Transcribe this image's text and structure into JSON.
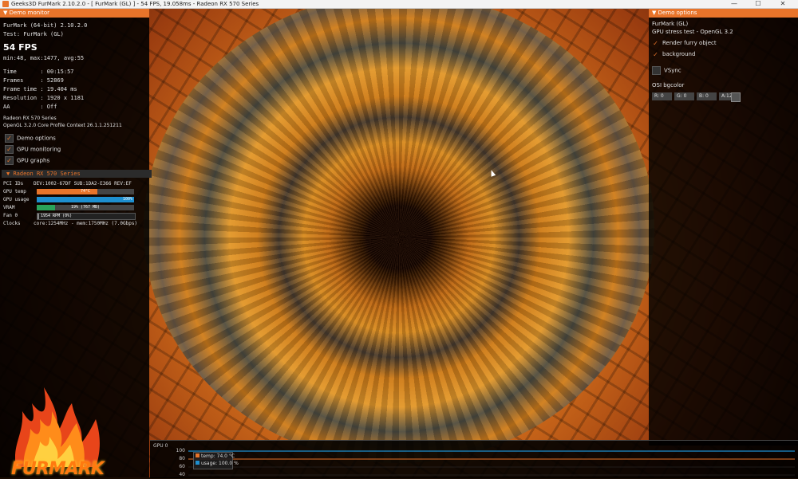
{
  "window": {
    "title": "Geeks3D FurMark 2.10.2.0 - [ FurMark (GL) ] - 54 FPS, 19.058ms - Radeon RX 570 Series",
    "minimize": "—",
    "maximize": "☐",
    "close": "✕"
  },
  "demo_monitor": {
    "header": "Demo monitor",
    "app_line": "FurMark (64-bit) 2.10.2.0",
    "test_line": "Test: FurMark (GL)",
    "fps": "54 FPS",
    "fps_stats": "min:48, max:1477, avg:55",
    "stats": [
      {
        "label": "Time       ",
        "value": ": 00:15:57"
      },
      {
        "label": "Frames     ",
        "value": ": 52869"
      },
      {
        "label": "Frame time ",
        "value": ": 19.404 ms"
      },
      {
        "label": "Resolution ",
        "value": ": 1920 x 1181"
      },
      {
        "label": "AA         ",
        "value": ": Off"
      }
    ],
    "gpu_name": "Radeon RX 570 Series",
    "gl_context": "OpenGL 3.2.0 Core Profile Context 26.1.1.251211",
    "checks": [
      {
        "label": "Demo options"
      },
      {
        "label": "GPU monitoring"
      },
      {
        "label": "GPU graphs"
      }
    ]
  },
  "gpu_panel": {
    "header": "Radeon RX 570 Series",
    "pci_label": "PCI IDs",
    "pci_value": "DEV:1002-67DF SUB:1DA2-E366 REV:EF",
    "rows": [
      {
        "label": "GPU temp",
        "text": "74°C",
        "fill": 0.62,
        "color": "#e8742a"
      },
      {
        "label": "GPU usage",
        "text": "100%",
        "fill": 1.0,
        "color": "#1e8fcf"
      },
      {
        "label": "VRAM",
        "text": "19% (767 MB)",
        "fill": 0.19,
        "color": "#2aa35a"
      },
      {
        "label": "Fan 0",
        "text": "1954 RPM (0%)",
        "fill": 0.02,
        "color": "#888888"
      }
    ],
    "clocks_label": "Clocks",
    "clocks_value": "core:1254MHz - mem:1750MHz (7.0Gbps)"
  },
  "logo_text": "FURMARK",
  "demo_options": {
    "header": "Demo options",
    "name": "FurMark (GL)",
    "subtitle": "GPU stress test - OpenGL 3.2",
    "checks": [
      {
        "label": "Render furry object",
        "checked": true
      },
      {
        "label": "background",
        "checked": true
      },
      {
        "label": "VSync",
        "checked": false
      }
    ],
    "osi_label": "OSI bgcolor",
    "rgba": {
      "r": "R: 0",
      "g": "G: 0",
      "b": "B: 0",
      "a": "A:128"
    }
  },
  "graph": {
    "label": "GPU 0",
    "yticks": [
      "100",
      "80",
      "60",
      "40"
    ],
    "legend": [
      {
        "text": "temp: 74.0 °C",
        "color": "#e8742a"
      },
      {
        "text": "usage: 100.0 %",
        "color": "#1e8fcf"
      }
    ]
  },
  "colors": {
    "accent": "#e8742a",
    "usage": "#1e8fcf",
    "vram": "#2aa35a"
  }
}
